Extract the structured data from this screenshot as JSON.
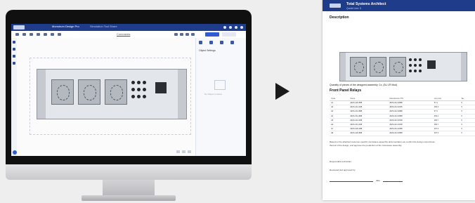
{
  "app": {
    "title": "Monstrum Design Pro",
    "tabs": [
      "Simulation Tool",
      "Share"
    ],
    "canvas_label": "Comments",
    "panel_title": "Object Settings",
    "panel_note": "No Object is Active"
  },
  "document": {
    "header_title": "Total Systems Architect",
    "header_subtitle": "Quote Line: 5",
    "description_heading": "Description",
    "quantity_text": "Quantity of pieces of the designed assembly: 1x, (3U LR Mod)",
    "front_panel_heading": "Front Panel Relays",
    "table": {
      "columns": [
        "Code",
        "Name",
        "Manufacturer PN",
        "List price",
        "Tax"
      ],
      "rows": [
        [
          "A1",
          "ZETA-420-888",
          "ZETA-012-9888",
          "57.3",
          "5"
        ],
        [
          "A2",
          "ZETA-412-008",
          "ZETA-012-9005",
          "182.6",
          "5"
        ],
        [
          "A3",
          "ZETA-412-888",
          "ZETA-012-9888",
          "57.3",
          "5"
        ],
        [
          "A4",
          "ZETA-412-888",
          "ZETA-012-9888",
          "153.1",
          "5"
        ],
        [
          "A5",
          "ZETA-412-008",
          "ZETA-012-9008",
          "182.7",
          "5"
        ],
        [
          "A6",
          "ZETA-412-008",
          "ZETA-012-9008",
          "182.7",
          "5"
        ],
        [
          "A7",
          "ZETA-420-088",
          "ZETA-012-9088",
          "197.3",
          "5"
        ],
        [
          "A8",
          "ZETA-420-888",
          "ZETA-012-9888",
          "197.3",
          "5"
        ]
      ]
    },
    "statement_line1": "Based on the attached customer-specific microwave assembly documentation we confirm the design correctness",
    "statement_line2": "thereof of the design, and approve the production of the microwave assembly.",
    "responsible_label": "Responsible technician:",
    "reviewed_label": "Reviewed and approved by:",
    "date_label": "date"
  },
  "colors": {
    "brand": "#1f3c8a",
    "accent": "#2f5bd3"
  }
}
